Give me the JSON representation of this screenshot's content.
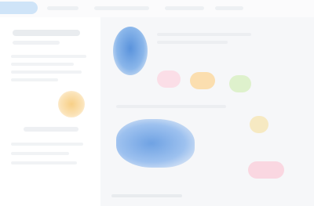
{
  "window": {
    "title": ""
  },
  "topbar": {
    "tab_label": "",
    "menu_items": [
      "",
      "",
      "",
      ""
    ]
  },
  "sidebar": {
    "title": "",
    "subtitle": "",
    "items": [
      "",
      "",
      "",
      "",
      "",
      "",
      ""
    ],
    "profile_name": ""
  },
  "content": {
    "section_labels": [
      "",
      ""
    ],
    "tags": [
      "",
      "",
      "",
      "",
      ""
    ]
  },
  "colors": {
    "accent_blue": "#5a93dc",
    "tab_blue": "#cfe4f8",
    "tag_pink": "#fbd9e4",
    "tag_orange": "#fbd9a2",
    "tag_green": "#d9f0c4",
    "tag_yellow": "#f6e6b8",
    "avatar_orange": "#f7cf86"
  }
}
